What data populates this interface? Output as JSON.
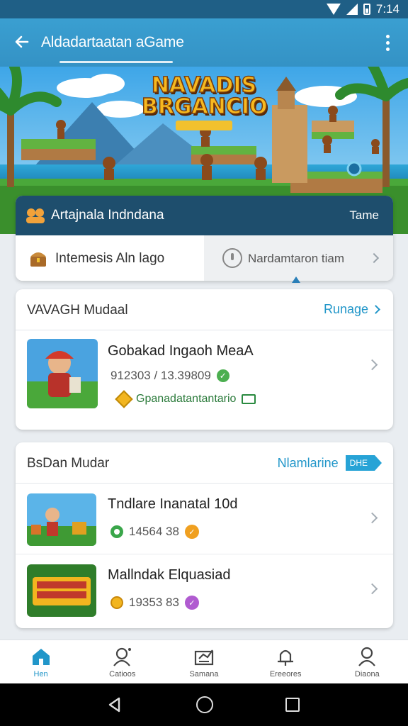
{
  "status_bar": {
    "time": "7:14"
  },
  "app_bar": {
    "title": "Aldadartaatan aGame"
  },
  "hero": {
    "title_line1": "NAVADIS",
    "title_line2": "BRGANCIO"
  },
  "user_panel": {
    "name": "Artajnala Indndana",
    "right_label": "Tame",
    "option_left": "Intemesis Aln lago",
    "option_right": "Nardamtaron tiam"
  },
  "section1": {
    "title": "VAVAGH Mudaal",
    "link_label": "Runage",
    "items": [
      {
        "title": "Gobakad Ingaoh MeaA",
        "stat": "912303 / 13.39809",
        "sub": "Gpanadatantantario"
      }
    ]
  },
  "section2": {
    "title": "BsDan Mudar",
    "link_label": "Nlamlarine",
    "link_badge": "DHE",
    "items": [
      {
        "title": "Tndlare Inanatal 10d",
        "stat": "14564 38"
      },
      {
        "title": "Mallndak Elquasiad",
        "stat": "19353 83"
      }
    ]
  },
  "bottom_nav": {
    "items": [
      {
        "label": "Hen",
        "icon": "home-icon",
        "active": true
      },
      {
        "label": "Catioos",
        "icon": "profile-icon",
        "active": false
      },
      {
        "label": "Samana",
        "icon": "certificate-icon",
        "active": false
      },
      {
        "label": "Ereeores",
        "icon": "bell-icon",
        "active": false
      },
      {
        "label": "Diaona",
        "icon": "user-icon",
        "active": false
      }
    ]
  },
  "colors": {
    "app_bar": "#3a9fd1",
    "status_bar": "#1f5f86",
    "panel_header": "#1e4e6d",
    "accent": "#2196c9"
  }
}
